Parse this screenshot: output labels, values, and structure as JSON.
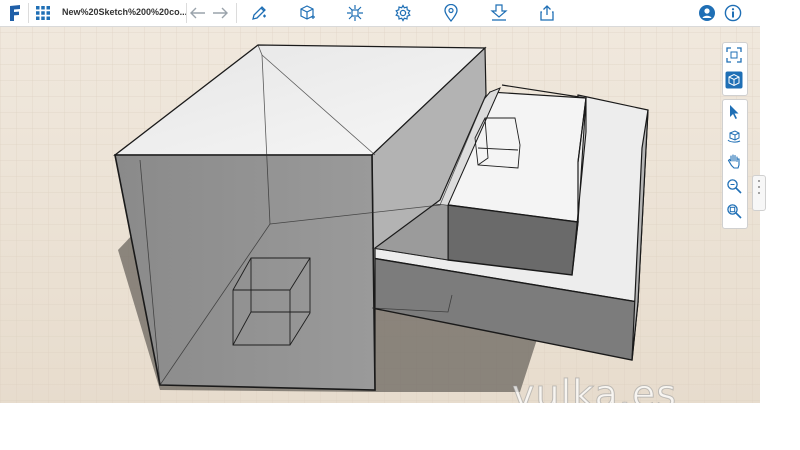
{
  "app": {
    "document_title": "New%20Sketch%200%20co..."
  },
  "toolbar": {
    "icons": [
      "app-logo-icon",
      "grid-menu-icon",
      "undo-icon",
      "redo-icon",
      "sketch-icon",
      "create-icon",
      "modify-icon",
      "settings-icon",
      "pin-icon",
      "download-icon",
      "share-icon",
      "account-icon",
      "info-icon"
    ]
  },
  "view_tools": {
    "icons": [
      "fit-view-icon",
      "view-cube-icon",
      "select-icon",
      "orbit-icon",
      "pan-icon",
      "zoom-icon",
      "zoom-window-icon"
    ]
  },
  "watermark": {
    "text": "vulka.es",
    "image_only": true
  },
  "colors": {
    "accent": "#1f6fb5",
    "ground": "#ede3d6",
    "grid_line": "#d9ccbc",
    "model_light": "#f2f2f2",
    "model_dark": "#6e6e6e"
  }
}
